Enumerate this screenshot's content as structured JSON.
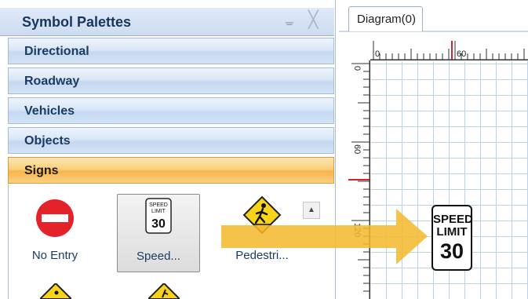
{
  "palette": {
    "title": "Symbol Palettes",
    "pin_glyph": "ᚚ",
    "close_glyph": "╳",
    "categories": [
      {
        "label": "Directional",
        "active": false
      },
      {
        "label": "Roadway",
        "active": false
      },
      {
        "label": "Vehicles",
        "active": false
      },
      {
        "label": "Objects",
        "active": false
      },
      {
        "label": "Signs",
        "active": true
      }
    ],
    "items": [
      {
        "label": "No Entry",
        "icon": "no-entry-icon"
      },
      {
        "label": "Speed...",
        "icon": "speed-limit-icon",
        "selected": true
      },
      {
        "label": "Pedestri...",
        "icon": "pedestrian-crossing-icon"
      }
    ],
    "speed_icon_lines": [
      "SPEED",
      "LIMIT",
      "30"
    ],
    "scroll_up_glyph": "▲"
  },
  "diagram": {
    "tab_label": "Diagram(0)",
    "ruler_top_labels": [
      "0",
      "60"
    ],
    "ruler_left_labels": [
      "0",
      "60",
      "120"
    ],
    "sign": {
      "line1": "SPEED",
      "line2": "LIMIT",
      "line3": "30"
    }
  },
  "colors": {
    "header_text": "#17365d",
    "active_category": "#f8b54c",
    "arrow": "#f5b92a",
    "no_entry_red": "#e3222a",
    "warning_yellow": "#f7d31a",
    "grid": "#b9d3ec"
  }
}
